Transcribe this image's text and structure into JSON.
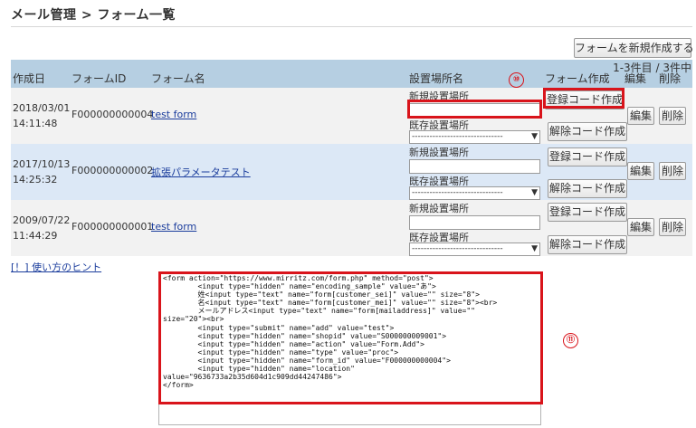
{
  "breadcrumb": "メール管理 > フォーム一覧",
  "new_form_button": "フォームを新規作成する",
  "count_text": "1-3件目 / 3件中",
  "headers": {
    "created": "作成日",
    "form_id": "フォームID",
    "form_name": "フォーム名",
    "location": "設置場所名",
    "form_create": "フォーム作成",
    "edit": "編集",
    "delete": "削除"
  },
  "rows": [
    {
      "date": "2018/03/01",
      "time": "14:11:48",
      "id": "F000000000004",
      "name": "test form"
    },
    {
      "date": "2017/10/13",
      "time": "14:25:32",
      "id": "F000000000002",
      "name": "拡張パラメータテスト"
    },
    {
      "date": "2009/07/22",
      "time": "11:44:29",
      "id": "F000000000001",
      "name": "test form"
    }
  ],
  "location_labels": {
    "new": "新規設置場所",
    "existing": "既存設置場所",
    "select_default": "-------------------------------"
  },
  "buttons": {
    "register_code": "登録コード作成",
    "cancel_code": "解除コード作成",
    "edit": "編集",
    "delete": "削除"
  },
  "hint_link": "[！] 使い方のヒント",
  "code_snippet": "<form action=\"https://www.mirritz.com/form.php\" method=\"post\">\n        <input type=\"hidden\" name=\"encoding_sample\" value=\"あ\">\n        姓<input type=\"text\" name=\"form[customer_sei]\" value=\"\" size=\"8\">\n        名<input type=\"text\" name=\"form[customer_mei]\" value=\"\" size=\"8\"><br>\n        メールアドレス<input type=\"text\" name=\"form[mailaddress]\" value=\"\"\nsize=\"20\"><br>\n        <input type=\"submit\" name=\"add\" value=\"test\">\n        <input type=\"hidden\" name=\"shopid\" value=\"S000000009001\">\n        <input type=\"hidden\" name=\"action\" value=\"Form.Add\">\n        <input type=\"hidden\" name=\"type\" value=\"proc\">\n        <input type=\"hidden\" name=\"form_id\" value=\"F000000000004\">\n        <input type=\"hidden\" name=\"location\"\nvalue=\"9636733a2b35d604d1c909dd44247486\">\n</form>",
  "callouts": {
    "a": "⑩",
    "b": "⑪"
  },
  "colors": {
    "header_bg": "#b6cfe2",
    "row_alt_bg": "#dce8f6",
    "row_bg": "#f2f2f2",
    "link": "#1a3c9c",
    "highlight": "#d9141b"
  }
}
